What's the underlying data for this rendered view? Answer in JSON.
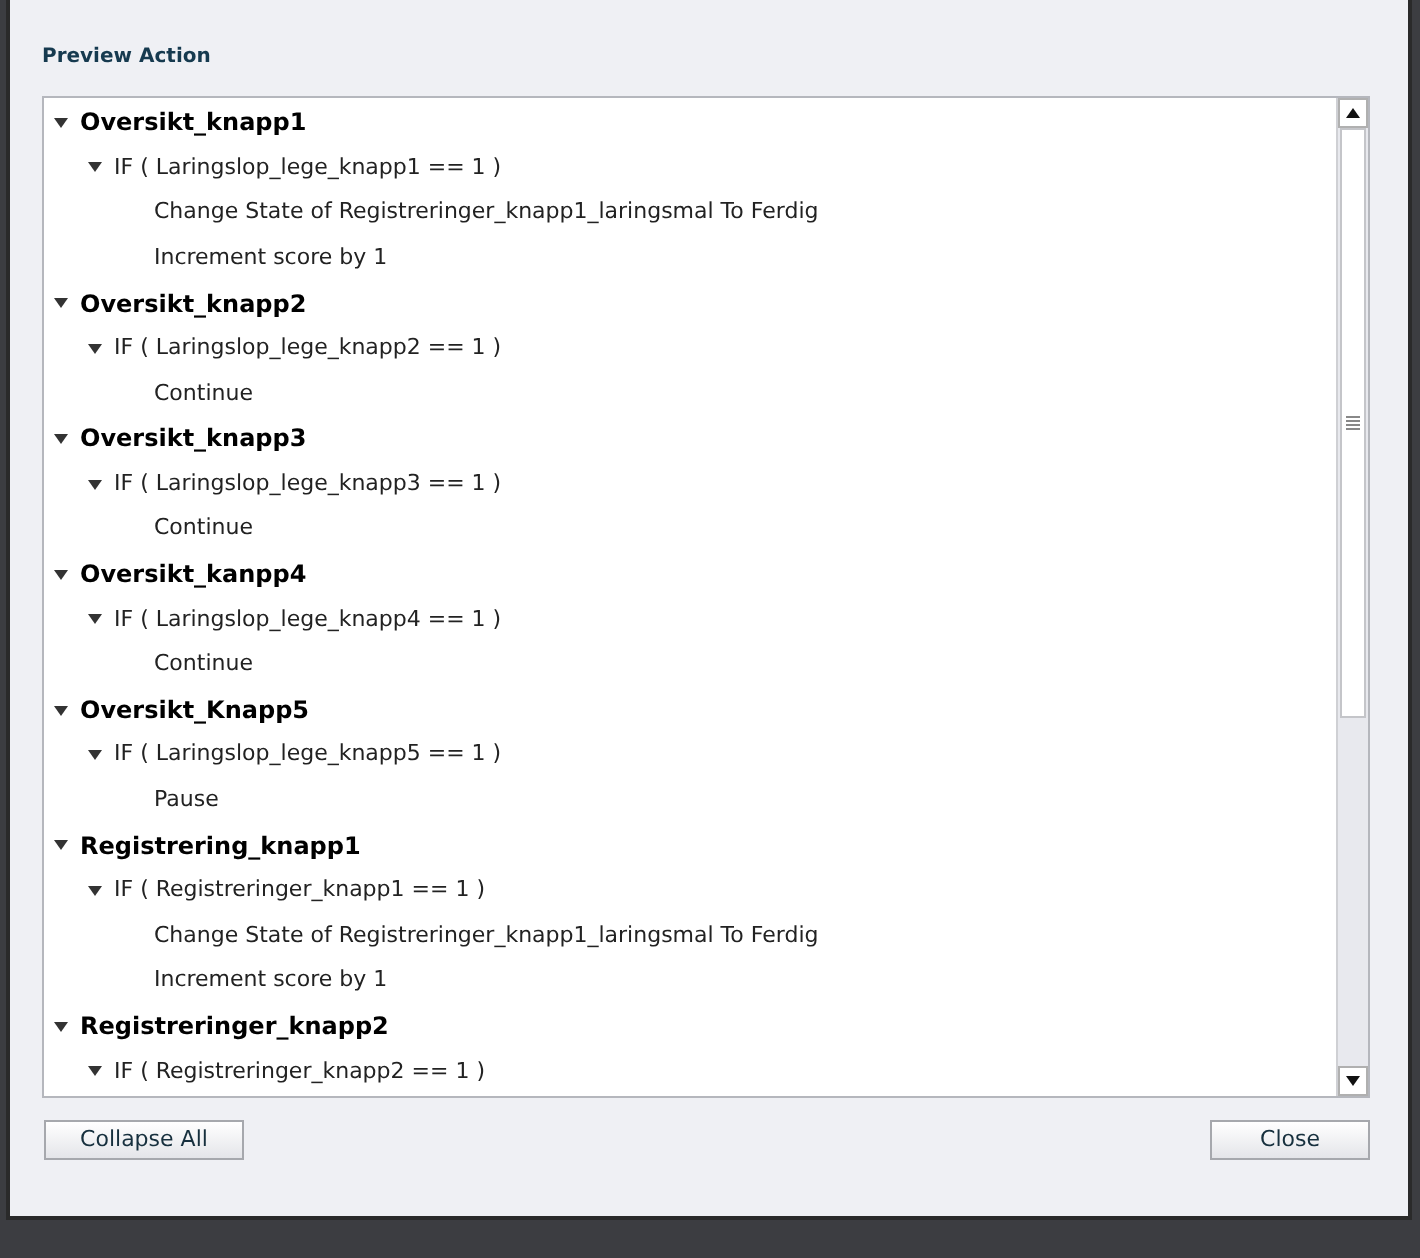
{
  "dialog": {
    "title": "Preview Action"
  },
  "tree": [
    {
      "label": "Oversikt_knapp1",
      "expanded": true,
      "children": [
        {
          "label": "IF ( Laringslop_lege_knapp1 == 1  )",
          "expanded": true,
          "children": [
            {
              "label": "Change State of Registreringer_knapp1_laringsmal To Ferdig"
            },
            {
              "label": "Increment score by 1"
            }
          ]
        }
      ]
    },
    {
      "label": "Oversikt_knapp2",
      "expanded": true,
      "children": [
        {
          "label": "IF ( Laringslop_lege_knapp2 == 1  )",
          "expanded": true,
          "children": [
            {
              "label": "Continue"
            }
          ]
        }
      ]
    },
    {
      "label": "Oversikt_knapp3",
      "expanded": true,
      "children": [
        {
          "label": "IF ( Laringslop_lege_knapp3 == 1  )",
          "expanded": true,
          "children": [
            {
              "label": "Continue"
            }
          ]
        }
      ]
    },
    {
      "label": "Oversikt_kanpp4",
      "expanded": true,
      "children": [
        {
          "label": "IF ( Laringslop_lege_knapp4 == 1  )",
          "expanded": true,
          "children": [
            {
              "label": "Continue"
            }
          ]
        }
      ]
    },
    {
      "label": "Oversikt_Knapp5",
      "expanded": true,
      "children": [
        {
          "label": "IF ( Laringslop_lege_knapp5 == 1  )",
          "expanded": true,
          "children": [
            {
              "label": "Pause"
            }
          ]
        }
      ]
    },
    {
      "label": "Registrering_knapp1",
      "expanded": true,
      "children": [
        {
          "label": "IF ( Registreringer_knapp1 == 1  )",
          "expanded": true,
          "children": [
            {
              "label": "Change State of Registreringer_knapp1_laringsmal To Ferdig"
            },
            {
              "label": "Increment score by 1"
            }
          ]
        }
      ]
    },
    {
      "label": "Registreringer_knapp2",
      "expanded": true,
      "children": [
        {
          "label": "IF ( Registreringer_knapp2 == 1  )",
          "expanded": true
        }
      ]
    }
  ],
  "buttons": {
    "left": "Collapse All",
    "right": "Close"
  }
}
